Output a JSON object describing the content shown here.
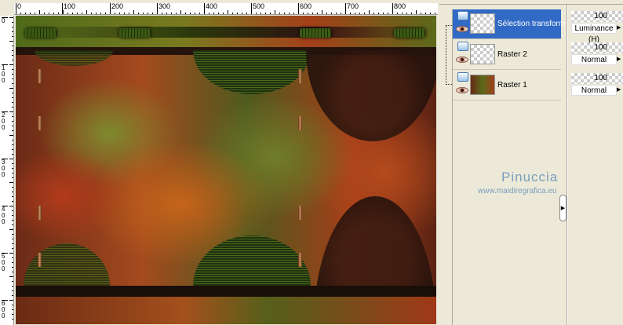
{
  "ruler": {
    "h_labels": [
      "0",
      "100",
      "200",
      "300",
      "400",
      "500",
      "600",
      "700",
      "800"
    ],
    "v_labels": [
      "0",
      "100",
      "200",
      "300",
      "400",
      "500",
      "600"
    ]
  },
  "layers": [
    {
      "name": "Sélection transform",
      "opacity": "100",
      "blend": "Luminance (H)",
      "selected": true
    },
    {
      "name": "Raster 2",
      "opacity": "100",
      "blend": "Normal",
      "selected": false
    },
    {
      "name": "Raster 1",
      "opacity": "100",
      "blend": "Normal",
      "selected": false
    }
  ],
  "watermark": {
    "name": "Pinuccia",
    "url": "www.maidiregrafica.eu"
  },
  "colors": {
    "selection": "#316ac5",
    "panel": "#ece9d8"
  }
}
